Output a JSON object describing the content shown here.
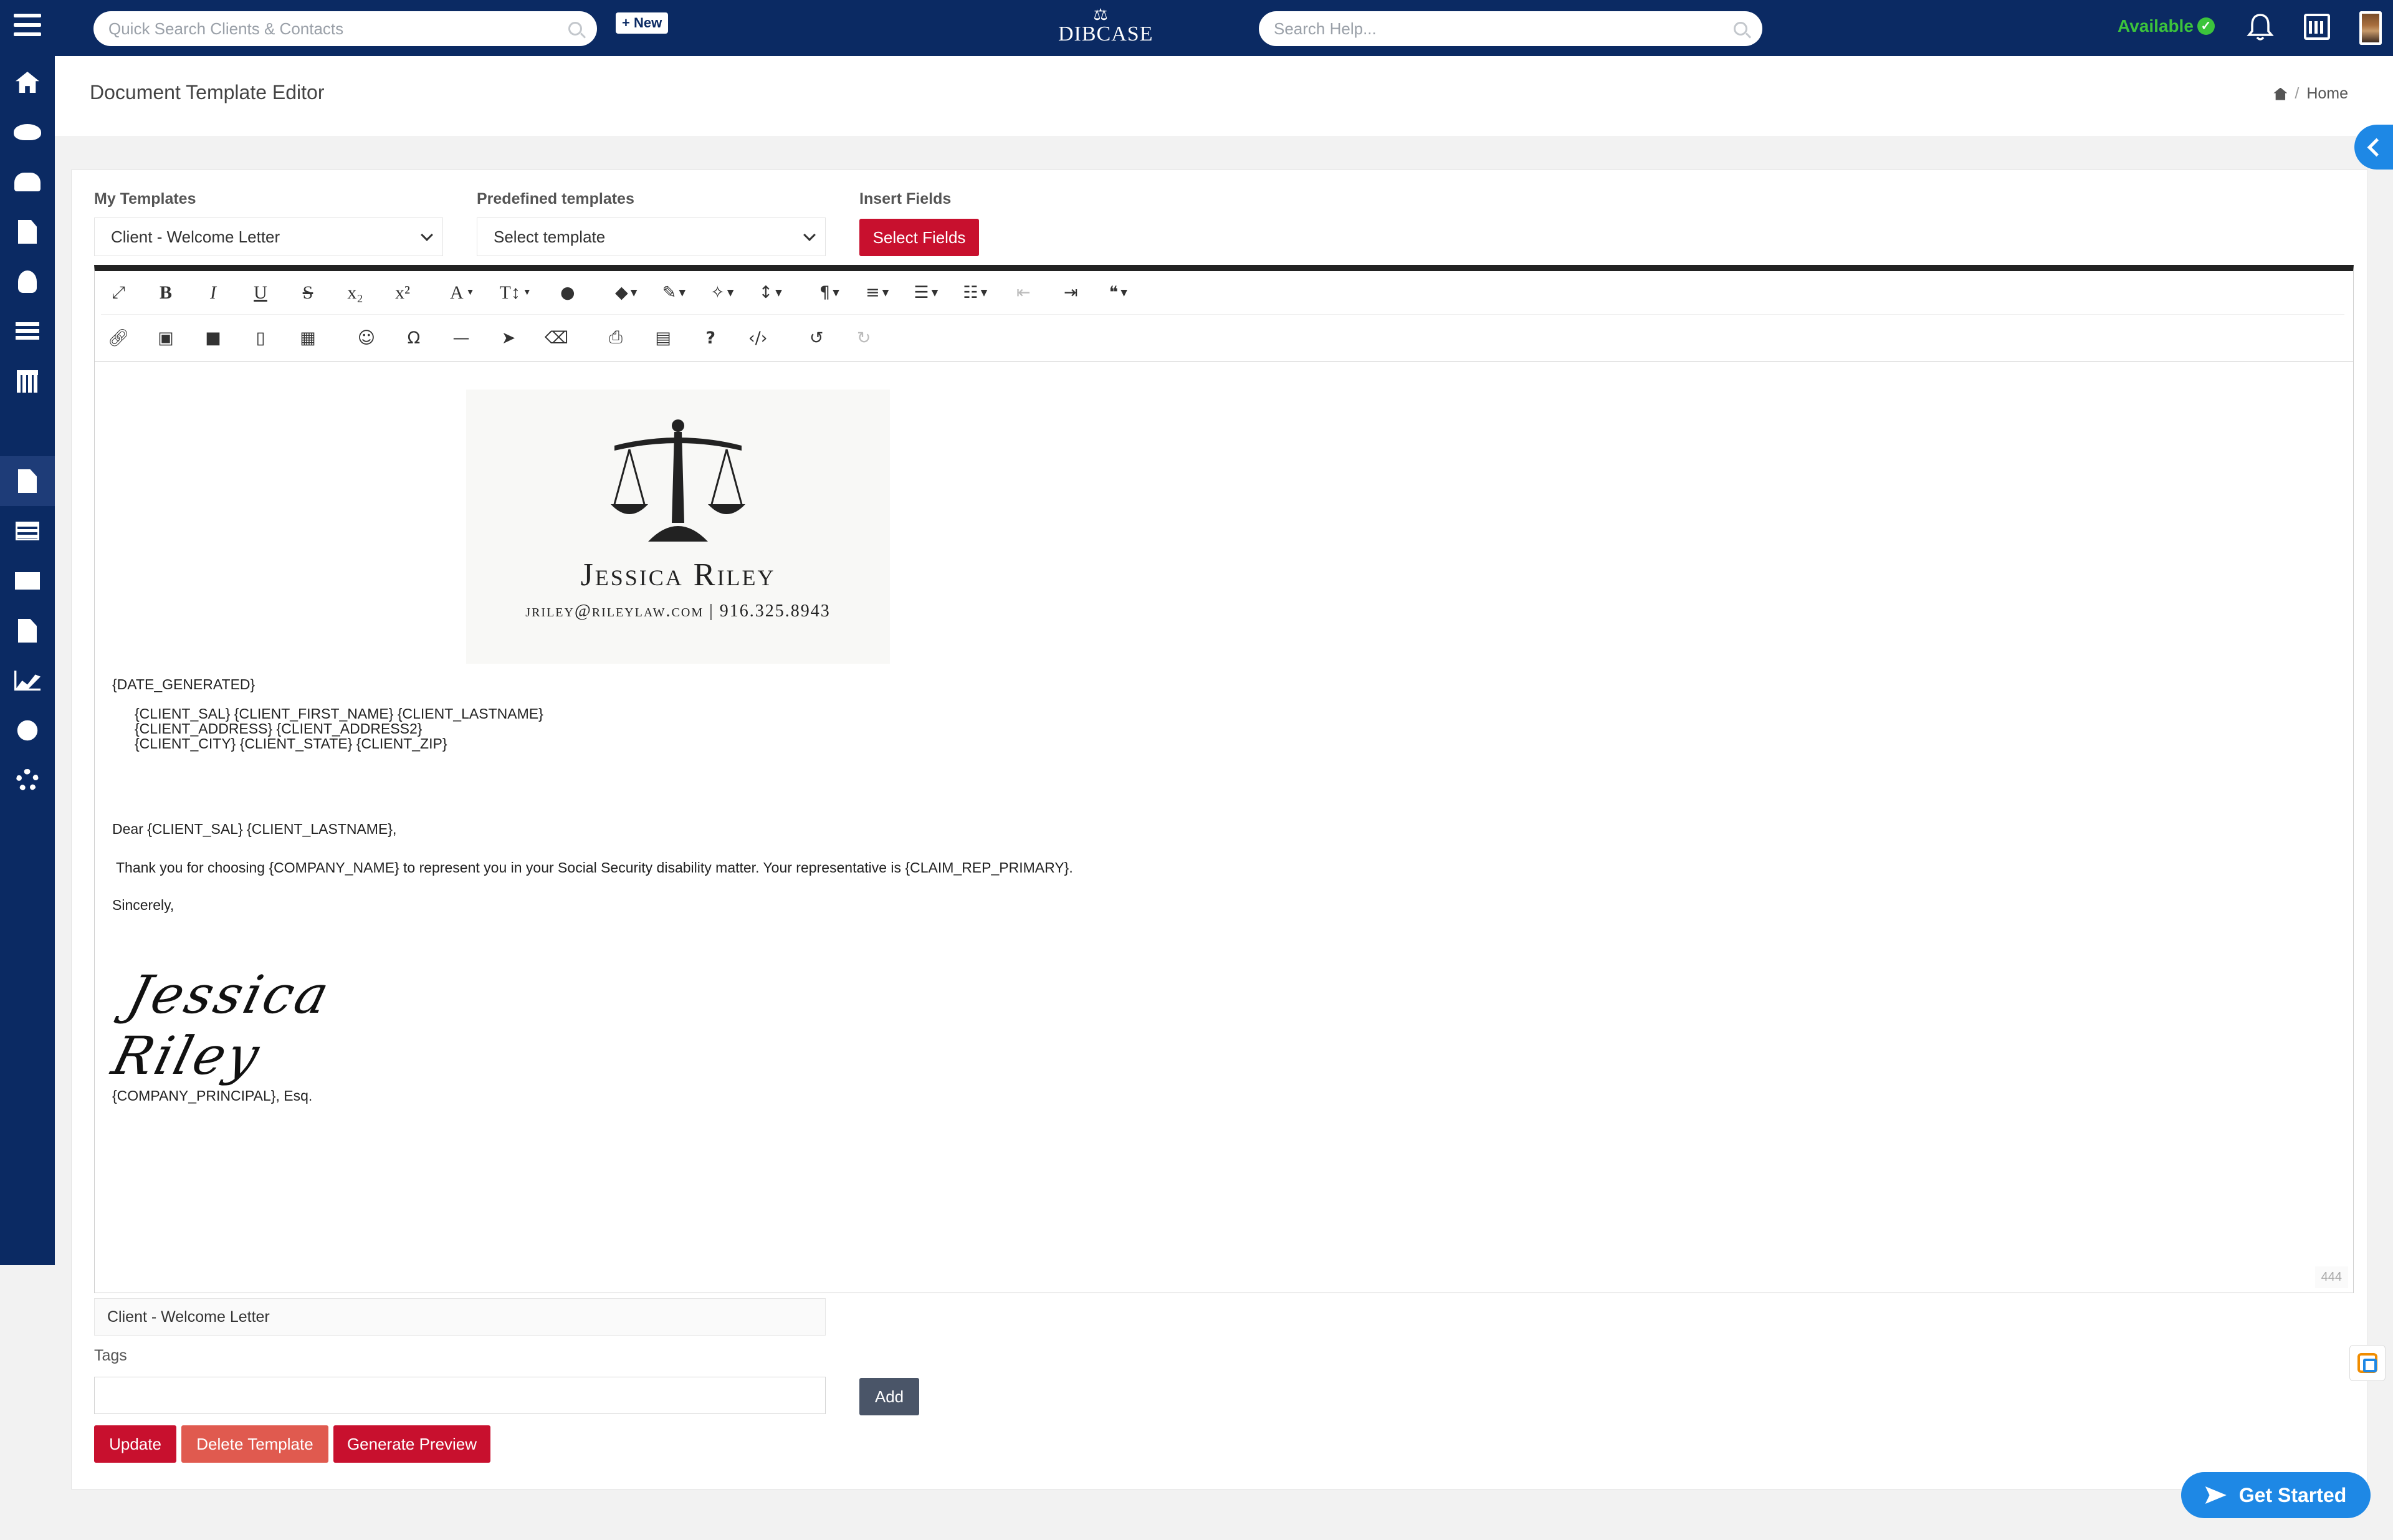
{
  "topbar": {
    "quick_search_placeholder": "Quick Search Clients & Contacts",
    "new_label": "+ New",
    "logo_text": "DIBCASE",
    "help_search_placeholder": "Search Help...",
    "status_label": "Available",
    "status_color": "#3cc43c"
  },
  "sidebar": {
    "items": [
      {
        "icon": "home-icon"
      },
      {
        "icon": "handshake-icon"
      },
      {
        "icon": "users-icon"
      },
      {
        "icon": "document-icon"
      },
      {
        "icon": "person-icon"
      },
      {
        "icon": "list-icon"
      },
      {
        "icon": "calendar-icon"
      },
      {
        "icon": "contact-card-icon"
      },
      {
        "icon": "file-icon",
        "active": true
      },
      {
        "icon": "table-icon"
      },
      {
        "icon": "mail-icon"
      },
      {
        "icon": "file-plus-icon"
      },
      {
        "icon": "line-chart-icon"
      },
      {
        "icon": "search-plus-icon"
      },
      {
        "icon": "gear-icon"
      }
    ]
  },
  "header": {
    "title": "Document Template Editor",
    "breadcrumb_home": "Home",
    "breadcrumb_sep": "/"
  },
  "form": {
    "my_templates_label": "My Templates",
    "my_templates_value": "Client - Welcome Letter",
    "predefined_label": "Predefined templates",
    "predefined_value": "Select template",
    "insert_fields_label": "Insert Fields",
    "select_fields_button": "Select Fields"
  },
  "toolbar": {
    "row1": [
      "expand-icon",
      "bold-icon",
      "italic-icon",
      "underline-icon",
      "strikethrough-icon",
      "subscript-icon",
      "superscript-icon",
      "font-family-icon",
      "font-size-icon",
      "text-color-icon",
      "tag-icon",
      "paint-brush-icon",
      "magic-wand-icon",
      "line-height-icon",
      "paragraph-icon",
      "align-icon",
      "ordered-list-icon",
      "unordered-list-icon",
      "outdent-icon",
      "indent-icon",
      "quote-icon"
    ],
    "row2": [
      "link-icon",
      "image-icon",
      "video-icon",
      "file-icon",
      "table-icon",
      "emoji-icon",
      "special-char-icon",
      "horizontal-line-icon",
      "select-all-icon",
      "clear-format-icon",
      "print-icon",
      "pdf-icon",
      "help-icon",
      "code-view-icon",
      "undo-icon",
      "redo-icon"
    ]
  },
  "document": {
    "letterhead_name": "Jessica Riley",
    "letterhead_email": "jriley@rileylaw.com",
    "letterhead_phone": "916.325.8943",
    "letterhead_divider": "|",
    "date_line": "{DATE_GENERATED}",
    "address_line1": "{CLIENT_SAL} {CLIENT_FIRST_NAME} {CLIENT_LASTNAME}",
    "address_line2": "{CLIENT_ADDRESS} {CLIENT_ADDRESS2}",
    "address_line3": "{CLIENT_CITY} {CLIENT_STATE} {CLIENT_ZIP}",
    "salutation": "Dear {CLIENT_SAL} {CLIENT_LASTNAME},",
    "body": " Thank you for choosing {COMPANY_NAME} to represent you in your Social Security disability matter. Your representative is {CLAIM_REP_PRIMARY}.",
    "closing": "Sincerely,",
    "signature": "Jessica Riley",
    "principal": "{COMPANY_PRINCIPAL}, Esq.",
    "char_count": "444"
  },
  "footer_form": {
    "template_name_value": "Client - Welcome Letter",
    "tags_label": "Tags",
    "tags_value": "",
    "add_button": "Add",
    "update_button": "Update",
    "delete_button": "Delete Template",
    "preview_button": "Generate Preview"
  },
  "widgets": {
    "get_started": "Get Started"
  },
  "colors": {
    "nav": "#0b2a63",
    "primary_red": "#c8102e",
    "delete_salmon": "#e05a4f",
    "accent_blue": "#1e88e5"
  }
}
